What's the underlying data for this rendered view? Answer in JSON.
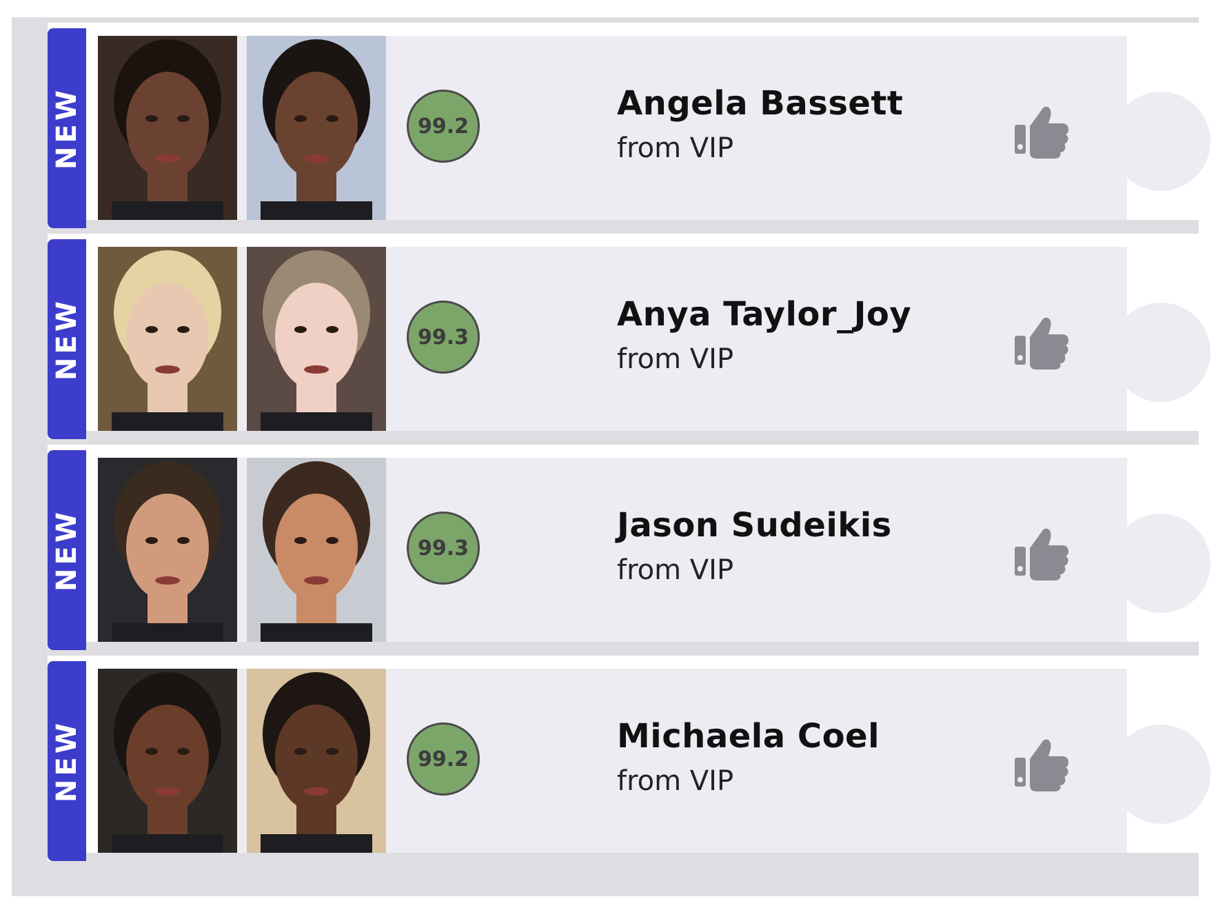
{
  "matches": [
    {
      "badge": "NEW",
      "name": "Angela Bassett",
      "source": "from VIP",
      "score": "99.2",
      "photo_a": {
        "bg": "#3a2a24",
        "skin": "#6b4232",
        "hair": "#1c120e"
      },
      "photo_b": {
        "bg": "#b9c4d6",
        "skin": "#6a4330",
        "hair": "#1a1412"
      }
    },
    {
      "badge": "NEW",
      "name": "Anya Taylor_Joy",
      "source": "from VIP",
      "score": "99.3",
      "photo_a": {
        "bg": "#6f5a3c",
        "skin": "#e8c8b0",
        "hair": "#e6d3a4"
      },
      "photo_b": {
        "bg": "#5c4a44",
        "skin": "#f0cfc4",
        "hair": "#9a8a74"
      }
    },
    {
      "badge": "NEW",
      "name": "Jason Sudeikis",
      "source": "from VIP",
      "score": "99.3",
      "photo_a": {
        "bg": "#2a2a2e",
        "skin": "#d29a7c",
        "hair": "#3a2a20"
      },
      "photo_b": {
        "bg": "#c8ccd2",
        "skin": "#c98a66",
        "hair": "#3c2a20"
      }
    },
    {
      "badge": "NEW",
      "name": "Michaela Coel",
      "source": "from VIP",
      "score": "99.2",
      "photo_a": {
        "bg": "#2c2826",
        "skin": "#6a3e2a",
        "hair": "#1a1412"
      },
      "photo_b": {
        "bg": "#d8c2a0",
        "skin": "#5e3826",
        "hair": "#1e1612"
      }
    }
  ],
  "colors": {
    "badge_bg": "#3d3dcc",
    "score_bg": "#7ca56a",
    "card_bg": "#ececf2",
    "thumb": "#8a8a92"
  },
  "icons": {
    "like": "thumbs-up-icon"
  }
}
